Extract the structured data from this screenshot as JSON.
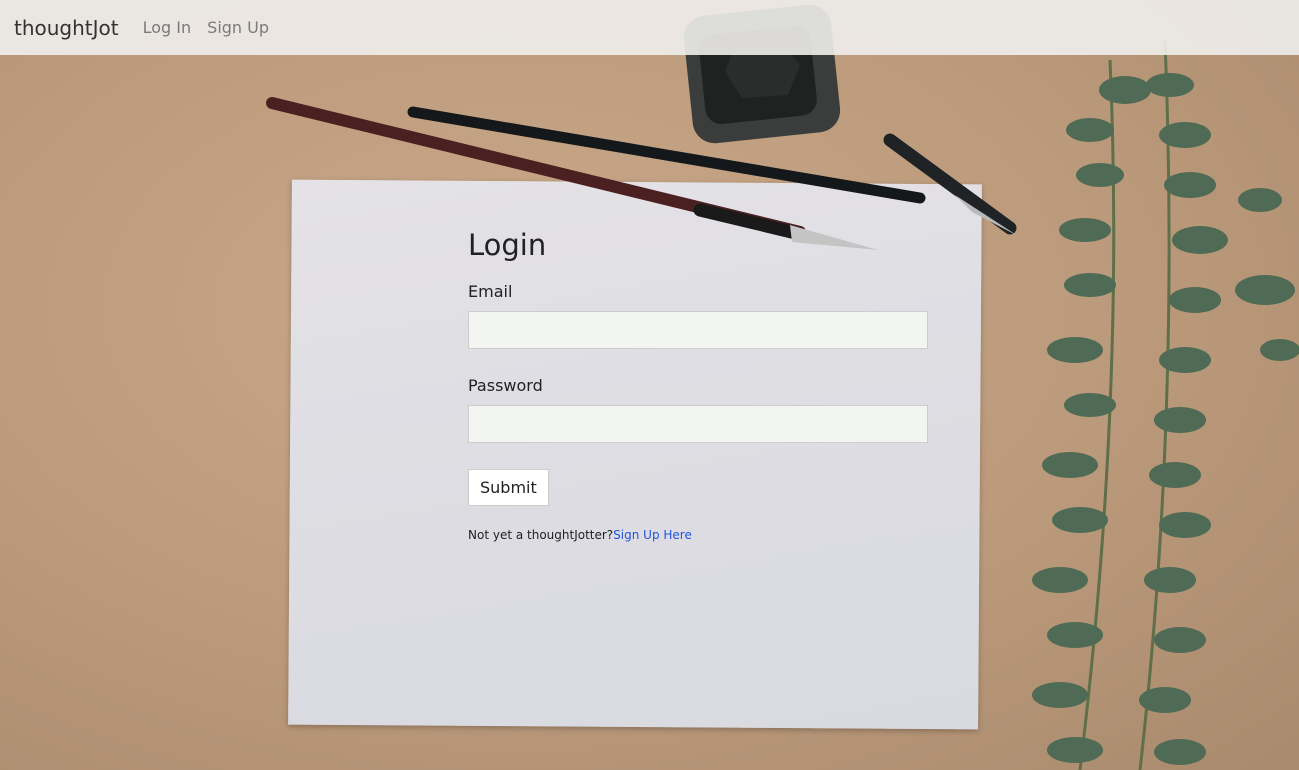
{
  "navbar": {
    "brand": "thoughtJot",
    "links": [
      {
        "label": "Log In"
      },
      {
        "label": "Sign Up"
      }
    ]
  },
  "login_form": {
    "title": "Login",
    "email_label": "Email",
    "email_value": "",
    "password_label": "Password",
    "password_value": "",
    "submit_label": "Submit",
    "prompt_text": "Not yet a thoughtJotter?",
    "signup_link": "Sign Up Here"
  },
  "colors": {
    "background": "#bb9a7b",
    "paper": "#dcdce2",
    "input_background": "#f2f5f1",
    "link": "#2255dd",
    "leaf": "#4f6a55"
  }
}
